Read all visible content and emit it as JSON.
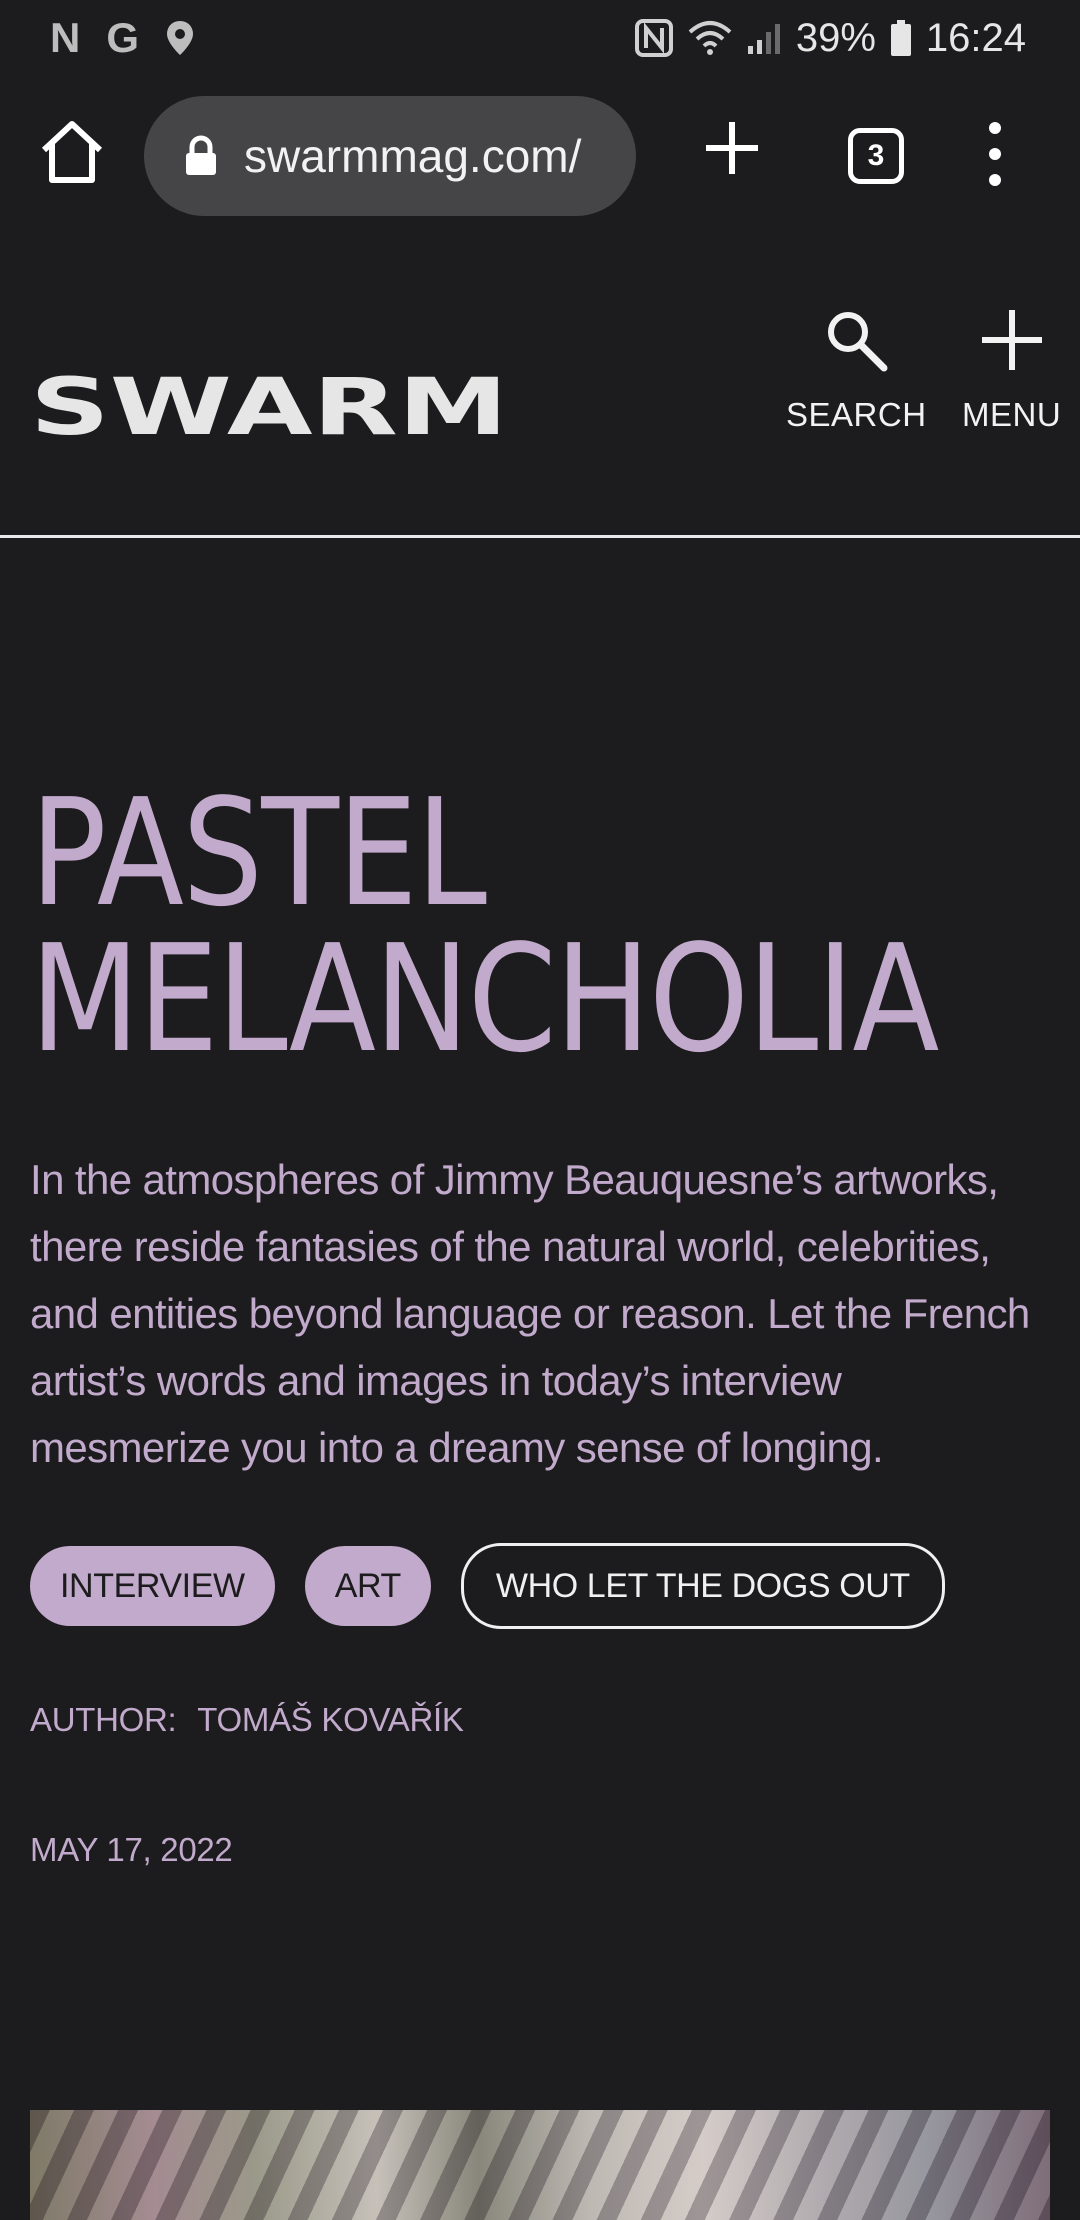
{
  "status_bar": {
    "left_glyphs": [
      "N",
      "G"
    ],
    "battery": "39%",
    "time": "16:24"
  },
  "browser": {
    "url": "swarmmag.com/",
    "tab_count": "3"
  },
  "site": {
    "logo": "SWARM",
    "search_label": "SEARCH",
    "menu_label": "MENU"
  },
  "article": {
    "title": "PASTEL MELANCHOLIA",
    "lede": "In the atmospheres of Jimmy Beauquesne’s artworks, there reside fantasies of the natural world, celebrities, and entities beyond language or reason. Let the French artist’s words and images in today’s interview mesmerize you into a dreamy sense of longing.",
    "tags": [
      "INTERVIEW",
      "ART",
      "WHO LET THE DOGS OUT"
    ],
    "author_label": "AUTHOR:",
    "author_name": "TOMÁŠ KOVAŘÍK",
    "date": "MAY 17, 2022"
  },
  "colors": {
    "background": "#1c1b1d",
    "accent_lilac": "#c1aacb",
    "url_pill": "#454548"
  }
}
